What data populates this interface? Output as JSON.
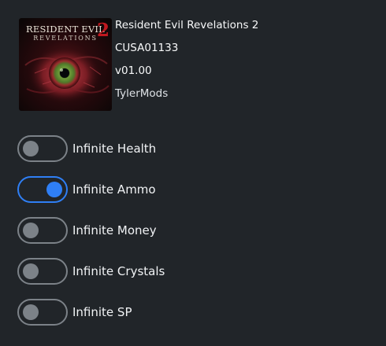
{
  "game": {
    "cover_title_line1": "RESIDENT EVIL",
    "cover_title_line2": "REVELATIONS",
    "cover_number": "2",
    "title": "Resident Evil Revelations 2",
    "id": "CUSA01133",
    "version": "v01.00",
    "author": "TylerMods"
  },
  "cheats": [
    {
      "label": "Infinite Health",
      "enabled": false
    },
    {
      "label": "Infinite Ammo",
      "enabled": true
    },
    {
      "label": "Infinite Money",
      "enabled": false
    },
    {
      "label": "Infinite Crystals",
      "enabled": false
    },
    {
      "label": "Infinite SP",
      "enabled": false
    }
  ],
  "colors": {
    "background": "#212529",
    "toggle_on": "#2f7ff5",
    "toggle_off": "#7c8288",
    "text": "#f1f3f5"
  }
}
